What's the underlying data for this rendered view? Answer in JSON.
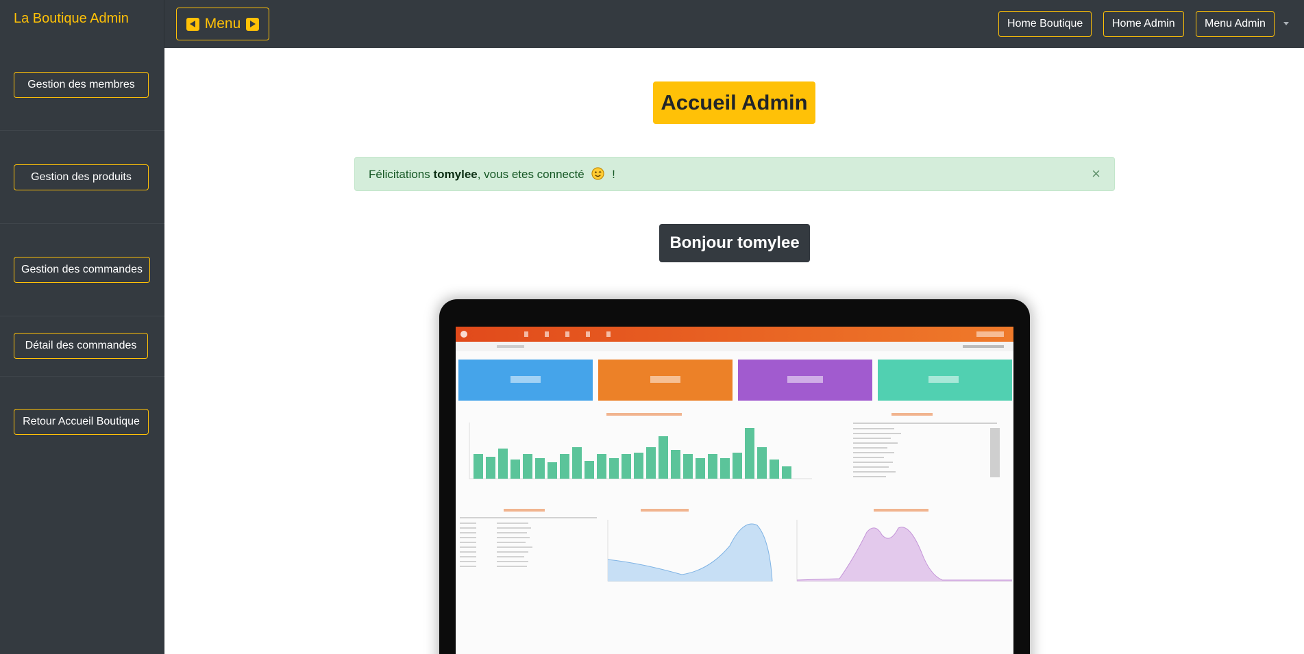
{
  "sidebar": {
    "brand": "La Boutique Admin",
    "items": [
      {
        "label": "Gestion  des  membres"
      },
      {
        "label": "Gestion   des   produits"
      },
      {
        "label": "Gestion des commandes"
      },
      {
        "label": "Détail des commandes"
      },
      {
        "label": "Retour Accueil Boutique"
      }
    ]
  },
  "topbar": {
    "menu_label": "Menu",
    "links": [
      {
        "label": "Home Boutique"
      },
      {
        "label": "Home Admin"
      },
      {
        "label": "Menu Admin"
      }
    ]
  },
  "main": {
    "title": "Accueil Admin",
    "alert": {
      "prefix": "Félicitations ",
      "username": "tomylee",
      "suffix": ", vous etes connecté",
      "end": " !",
      "close": "×"
    },
    "greeting": "Bonjour tomylee"
  },
  "colors": {
    "sidebar_bg": "#343a40",
    "accent": "#ffc107",
    "alert_bg": "#d4edda",
    "alert_text": "#155724"
  },
  "icons": {
    "menu_left": "caret-left-square-icon",
    "menu_right": "caret-right-square-icon",
    "dropdown": "caret-down-icon",
    "smiley": "winking-face-icon",
    "close": "close-icon"
  }
}
